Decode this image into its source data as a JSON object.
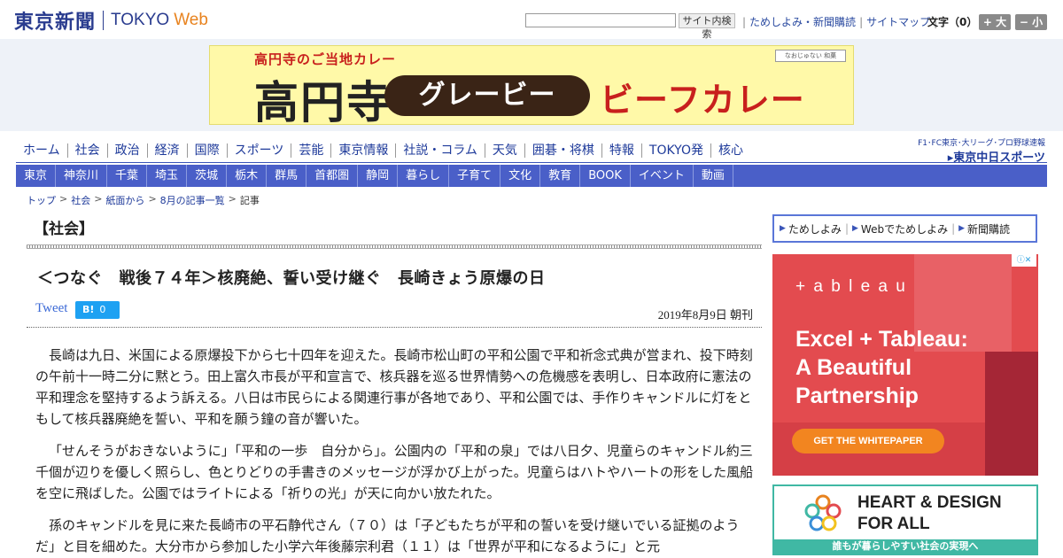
{
  "header": {
    "logo_jp": "東京新聞",
    "logo_en1": "TOKYO",
    "logo_en2": "Web",
    "search_button": "サイト内検索",
    "links": [
      "ためしよみ・新聞購読",
      "サイトマップ"
    ],
    "font_size_label": "文字（0）",
    "font_plus": "+ 大",
    "font_minus": "− 小"
  },
  "banner": {
    "sub": "高円寺のご当地カレー",
    "big": "高円寺",
    "pill": "グレービー",
    "red": "ビーフカレー",
    "badge": "なおじゅない 和菓"
  },
  "nav_primary": [
    "ホーム",
    "社会",
    "政治",
    "経済",
    "国際",
    "スポーツ",
    "芸能",
    "東京情報",
    "社説・コラム",
    "天気",
    "囲碁・将棋",
    "特報",
    "TOKYO発",
    "核心"
  ],
  "nav_right": {
    "small": "F1･FC東京･大リーグ･プロ野球速報",
    "chunichi": "▸東京中日スポーツ"
  },
  "nav_secondary": [
    "東京",
    "神奈川",
    "千葉",
    "埼玉",
    "茨城",
    "栃木",
    "群馬",
    "首都圏",
    "静岡",
    "暮らし",
    "子育て",
    "文化",
    "教育",
    "BOOK",
    "イベント",
    "動画"
  ],
  "breadcrumb": {
    "items": [
      "トップ",
      "社会",
      "紙面から",
      "8月の記事一覧"
    ],
    "current": "記事",
    "separator": ">"
  },
  "section_title": "【社会】",
  "article": {
    "headline": "＜つなぐ　戦後７４年＞核廃絶、誓い受け継ぐ　長崎きょう原爆の日",
    "tweet": "Tweet",
    "hatena_label": "B!",
    "hatena_count": "0",
    "date": "2019年8月9日 朝刊",
    "paragraphs": [
      "長崎は九日、米国による原爆投下から七十四年を迎えた。長崎市松山町の平和公園で平和祈念式典が営まれ、投下時刻の午前十一時二分に黙とう。田上富久市長が平和宣言で、核兵器を巡る世界情勢への危機感を表明し、日本政府に憲法の平和理念を堅持するよう訴える。八日は市民らによる関連行事が各地であり、平和公園では、手作りキャンドルに灯をともして核兵器廃絶を誓い、平和を願う鐘の音が響いた。",
      "「せんそうがおきないように」「平和の一歩　自分から」。公園内の「平和の泉」では八日夕、児童らのキャンドル約三千個が辺りを優しく照らし、色とりどりの手書きのメッセージが浮かび上がった。児童らはハトやハートの形をした風船を空に飛ばした。公園ではライトによる「祈りの光」が天に向かい放たれた。",
      "孫のキャンドルを見に来た長崎市の平石静代さん（７０）は「子どもたちが平和の誓いを受け継いでいる証拠のようだ」と目を細めた。大分市から参加した小学六年後藤宗利君（１１）は「世界が平和になるように」と元"
    ]
  },
  "sidebar": {
    "links": [
      "ためしよみ",
      "Webでためしよみ",
      "新聞購読"
    ]
  },
  "ad_tableau": {
    "adchoice": "ⓘ✕",
    "logo": "+ a b l e a u",
    "headline": [
      "Excel + Tableau:",
      "A Beautiful",
      "Partnership"
    ],
    "cta": "GET THE WHITEPAPER"
  },
  "ad_heart": {
    "line1": "HEART & DESIGN",
    "line2": "FOR ALL",
    "bar": "誰もが暮らしやすい社会の実現へ"
  }
}
